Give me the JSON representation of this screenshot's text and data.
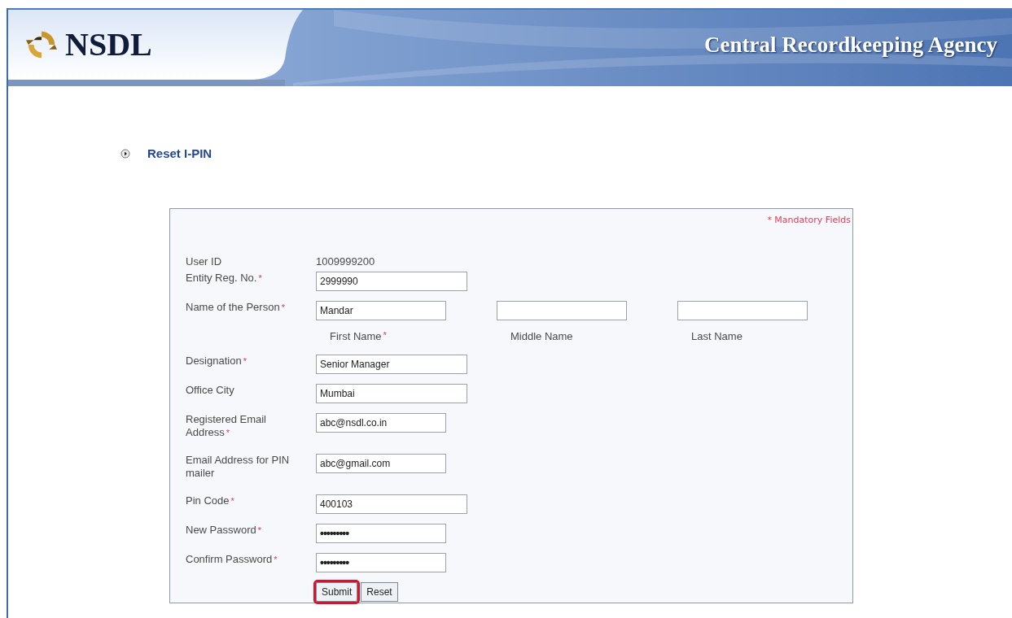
{
  "header": {
    "brand": "NSDL",
    "title": "Central Recordkeeping Agency"
  },
  "page_title": "Reset I-PIN",
  "form": {
    "mandatory_note": "* Mandatory Fields",
    "fields": [
      {
        "kind": "static",
        "label": "User ID",
        "value": "1009999200"
      },
      {
        "kind": "text",
        "label": "Entity Reg. No.",
        "required_mark": "*",
        "value": "2999990"
      },
      {
        "kind": "name",
        "label": "Name of the Person",
        "required_mark": "*",
        "parts": [
          {
            "value": "Mandar",
            "caption": "First Name",
            "required_mark": "*"
          },
          {
            "caption": "Middle Name"
          },
          {
            "caption": "Last Name"
          }
        ]
      },
      {
        "kind": "text",
        "label": "Designation",
        "required_mark": "*",
        "value": "Senior Manager"
      },
      {
        "kind": "text",
        "label": "Office City",
        "value": "Mumbai"
      },
      {
        "kind": "short",
        "label": "Registered Email Address",
        "required_mark": "*",
        "value": "abc@nsdl.co.in"
      },
      {
        "kind": "short",
        "label": "Email Address for PIN mailer",
        "value": "abc@gmail.com"
      },
      {
        "kind": "text",
        "label": "Pin Code",
        "required_mark": "*",
        "value": "400103"
      },
      {
        "kind": "password",
        "label": "New Password",
        "required_mark": "*",
        "value": "•••••••••"
      },
      {
        "kind": "password",
        "label": "Confirm Password",
        "required_mark": "*",
        "value": "•••••••••"
      }
    ]
  },
  "buttons": [
    {
      "label": "Submit",
      "highlighted": true
    },
    {
      "label": "Reset",
      "highlighted": false
    }
  ]
}
